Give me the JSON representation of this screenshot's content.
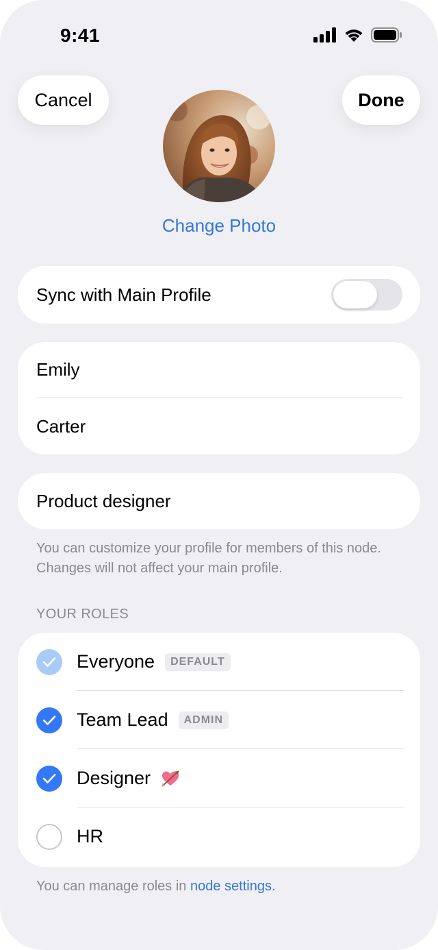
{
  "status_bar": {
    "time": "9:41"
  },
  "nav": {
    "cancel_label": "Cancel",
    "done_label": "Done"
  },
  "profile": {
    "change_photo_label": "Change Photo"
  },
  "sync": {
    "label": "Sync with Main Profile",
    "enabled": false
  },
  "name": {
    "first_name": "Emily",
    "last_name": "Carter"
  },
  "job_title": "Product designer",
  "customize_note": "You can customize your profile for members of this node. Changes will not affect your main profile.",
  "roles_section": {
    "header": "YOUR ROLES",
    "roles": [
      {
        "name": "Everyone",
        "badge": "DEFAULT",
        "checked": true,
        "disabled": true
      },
      {
        "name": "Team Lead",
        "badge": "ADMIN",
        "checked": true,
        "disabled": false
      },
      {
        "name": "Designer",
        "emoji": "heart-with-arrow-icon",
        "checked": true,
        "disabled": false
      },
      {
        "name": "HR",
        "checked": false,
        "disabled": false
      }
    ]
  },
  "manage_note": {
    "prefix": "You can manage roles in ",
    "link": "node settings."
  },
  "colors": {
    "accent": "#3478d6",
    "background": "#efeff4",
    "check_on": "#3478f6",
    "check_disabled": "#a9cbf7"
  }
}
